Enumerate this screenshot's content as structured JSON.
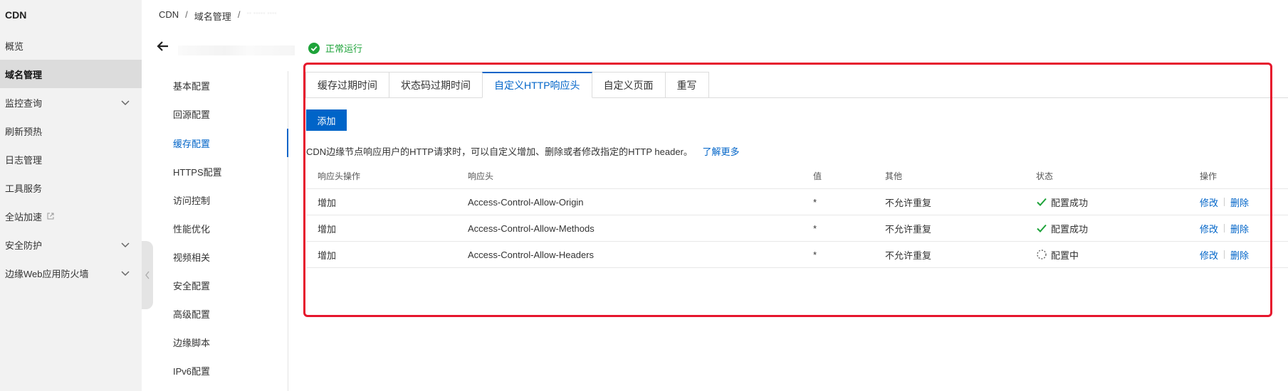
{
  "nav": {
    "brand": "CDN",
    "items": [
      {
        "label": "概览"
      },
      {
        "label": "域名管理"
      },
      {
        "label": "监控查询"
      },
      {
        "label": "刷新预热"
      },
      {
        "label": "日志管理"
      },
      {
        "label": "工具服务"
      },
      {
        "label": "全站加速"
      },
      {
        "label": "安全防护"
      },
      {
        "label": "边缘Web应用防火墙"
      }
    ]
  },
  "breadcrumb": {
    "root": "CDN",
    "sep": "/",
    "section": "域名管理",
    "domain_blurred": "·· ····· ····"
  },
  "status": {
    "label": "正常运行",
    "color": "#1ea33a"
  },
  "submenu": {
    "items": [
      {
        "label": "基本配置"
      },
      {
        "label": "回源配置"
      },
      {
        "label": "缓存配置"
      },
      {
        "label": "HTTPS配置"
      },
      {
        "label": "访问控制"
      },
      {
        "label": "性能优化"
      },
      {
        "label": "视频相关"
      },
      {
        "label": "安全配置"
      },
      {
        "label": "高级配置"
      },
      {
        "label": "边缘脚本"
      },
      {
        "label": "IPv6配置"
      }
    ]
  },
  "tabs": [
    {
      "label": "缓存过期时间"
    },
    {
      "label": "状态码过期时间"
    },
    {
      "label": "自定义HTTP响应头"
    },
    {
      "label": "自定义页面"
    },
    {
      "label": "重写"
    }
  ],
  "toolbar": {
    "add_label": "添加"
  },
  "description": {
    "text": "CDN边缘节点响应用户的HTTP请求时，可以自定义增加、删除或者修改指定的HTTP header。",
    "link": "了解更多"
  },
  "table": {
    "headers": [
      "响应头操作",
      "响应头",
      "值",
      "其他",
      "状态",
      "操作"
    ],
    "rows": [
      {
        "op": "增加",
        "header": "Access-Control-Allow-Origin",
        "value": "*",
        "other": "不允许重复",
        "status": "配置成功",
        "status_icon": "check-icon",
        "edit": "修改",
        "delete": "删除"
      },
      {
        "op": "增加",
        "header": "Access-Control-Allow-Methods",
        "value": "*",
        "other": "不允许重复",
        "status": "配置成功",
        "status_icon": "check-icon",
        "edit": "修改",
        "delete": "删除"
      },
      {
        "op": "增加",
        "header": "Access-Control-Allow-Headers",
        "value": "*",
        "other": "不允许重复",
        "status": "配置中",
        "status_icon": "spinner-icon",
        "edit": "修改",
        "delete": "删除"
      }
    ]
  },
  "colors": {
    "accent": "#0064c8",
    "success": "#1ea33a",
    "annotation": "#e6162d"
  }
}
